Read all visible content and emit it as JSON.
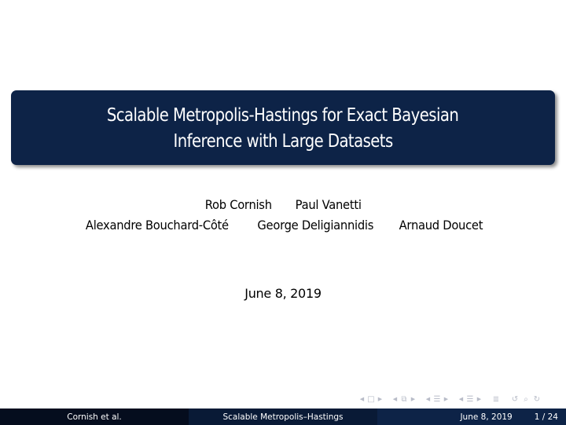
{
  "slide": {
    "title_lines": [
      "Scalable Metropolis-Hastings for Exact Bayesian",
      "Inference with Large Datasets"
    ],
    "authors_row1": [
      "Rob Cornish",
      "Paul Vanetti"
    ],
    "authors_row2": [
      "Alexandre Bouchard-Côté",
      "George Deligiannidis",
      "Arnaud Doucet"
    ],
    "date": "June 8, 2019"
  },
  "navigation": {
    "icons": [
      "frame-prev-icon",
      "frame-icon",
      "frame-next-icon",
      "subsection-prev-icon",
      "subsection-icon",
      "subsection-next-icon",
      "section-prev-icon",
      "section-icon",
      "section-next-icon",
      "slide-prev-icon",
      "slide-icon",
      "slide-next-icon",
      "toc-icon",
      "back-icon",
      "search-icon",
      "forward-icon"
    ]
  },
  "footer": {
    "author": "Cornish et al.",
    "short_title": "Scalable Metropolis–Hastings",
    "date": "June 8, 2019",
    "page": "1 / 24"
  },
  "colors": {
    "title_box": "#0d2347",
    "footer_left": "#050d1e",
    "footer_mid": "#091a36",
    "footer_right": "#0d2347"
  }
}
